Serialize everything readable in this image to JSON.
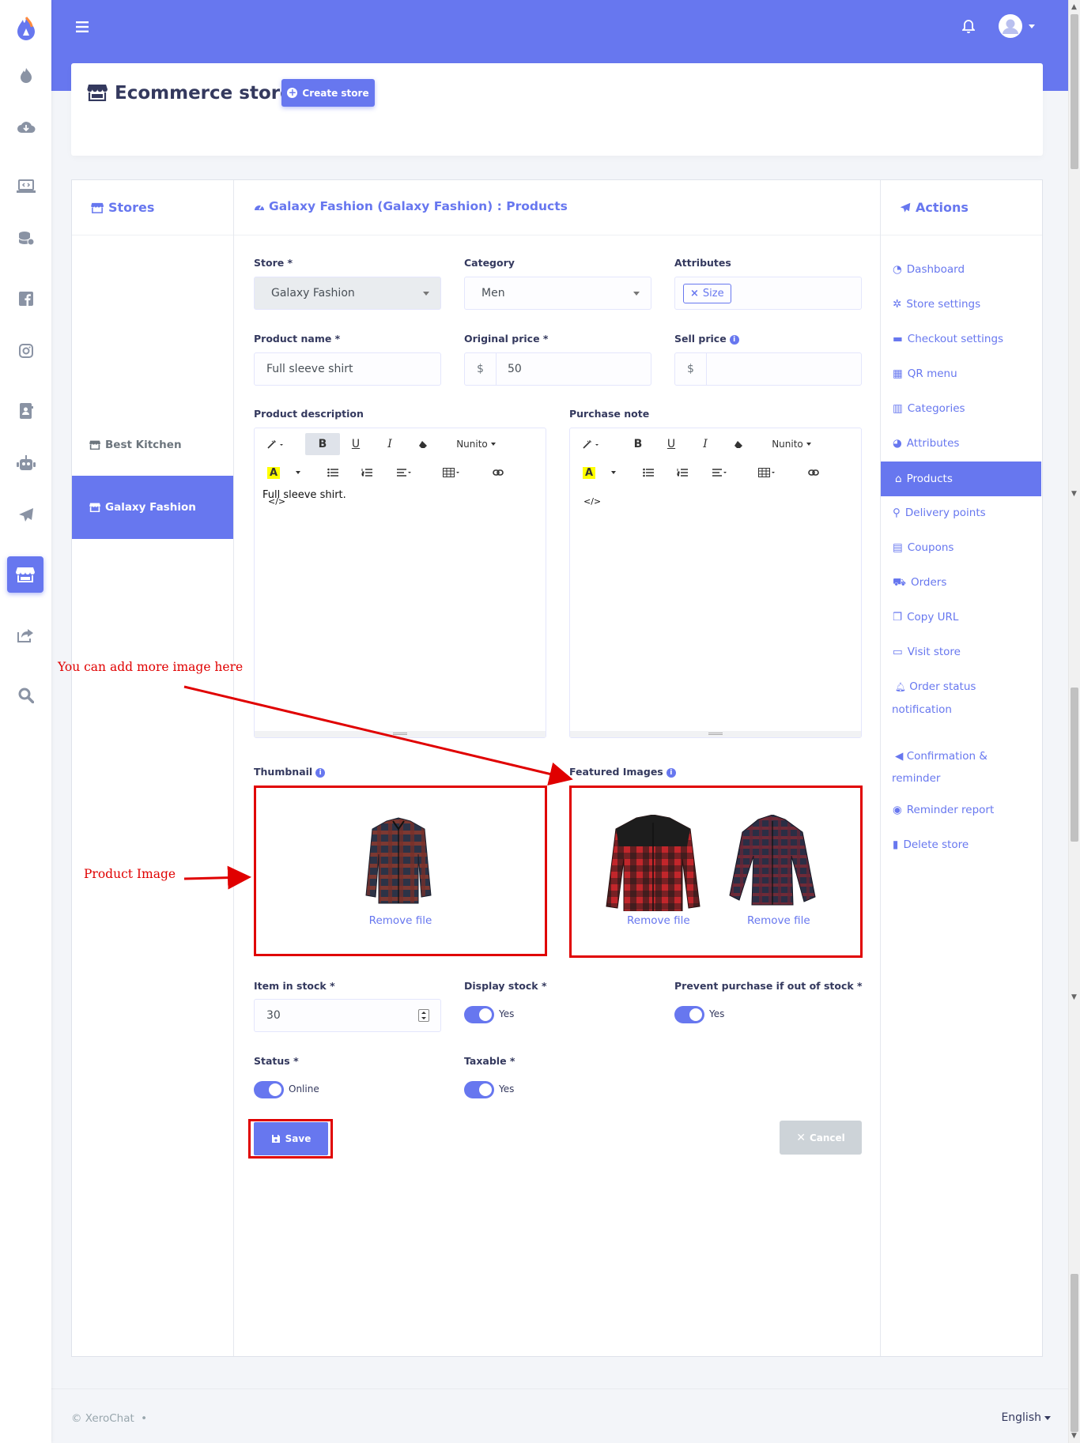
{
  "app": {
    "brand_icon": "flame-app-logo-icon"
  },
  "rail": {
    "icons": [
      "logo-icon",
      "fire-icon",
      "cloud-download-icon",
      "laptop-code-icon",
      "database-icon",
      "facebook-icon",
      "instagram-icon",
      "contact-book-icon",
      "robot-icon",
      "paper-plane-icon",
      "store-icon",
      "share-icon",
      "search-icon"
    ],
    "active": "store-icon"
  },
  "topbar": {
    "menu_icon": "hamburger-icon",
    "bell_icon": "bell-icon",
    "avatar_icon": "user-avatar-icon"
  },
  "header": {
    "title": "Ecommerce store",
    "create_button": "Create store"
  },
  "stores": {
    "heading": "Stores",
    "items": [
      {
        "label": "Best Kitchen",
        "active": false
      },
      {
        "label": "Galaxy Fashion",
        "active": true
      }
    ]
  },
  "main": {
    "title": "Galaxy Fashion (Galaxy Fashion) : Products"
  },
  "form": {
    "store_label": "Store *",
    "store_value": "Galaxy Fashion",
    "category_label": "Category",
    "category_value": "Men",
    "attributes_label": "Attributes",
    "attribute_tag": "Size",
    "product_name_label": "Product name *",
    "product_name_value": "Full sleeve shirt",
    "original_price_label": "Original price *",
    "currency": "$",
    "original_price_value": "50",
    "sell_price_label": "Sell price",
    "sell_price_value": "",
    "description_label": "Product description",
    "description_text": "Full sleeve shirt.",
    "purchase_note_label": "Purchase note",
    "font_name": "Nunito",
    "code_view": "</>",
    "thumbnail_label": "Thumbnail",
    "featured_label": "Featured Images",
    "remove_file": "Remove file",
    "stock_label": "Item in stock *",
    "stock_value": "30",
    "display_stock_label": "Display stock *",
    "display_stock_value": "Yes",
    "prevent_label": "Prevent purchase if out of stock *",
    "prevent_value": "Yes",
    "status_label": "Status *",
    "status_value": "Online",
    "taxable_label": "Taxable *",
    "taxable_value": "Yes",
    "save": "Save",
    "cancel": "Cancel"
  },
  "actions": {
    "heading": "Actions",
    "items": [
      {
        "label": "Dashboard",
        "icon": "dashboard-icon"
      },
      {
        "label": "Store settings",
        "icon": "gear-icon"
      },
      {
        "label": "Checkout settings",
        "icon": "credit-card-icon"
      },
      {
        "label": "QR menu",
        "icon": "qrcode-icon"
      },
      {
        "label": "Categories",
        "icon": "columns-icon"
      },
      {
        "label": "Attributes",
        "icon": "palette-icon"
      },
      {
        "label": "Products",
        "icon": "store-icon",
        "active": true
      },
      {
        "label": "Delivery points",
        "icon": "map-marker-icon"
      },
      {
        "label": "Coupons",
        "icon": "coupon-icon"
      },
      {
        "label": "Orders",
        "icon": "cart-icon"
      },
      {
        "label": "Copy URL",
        "icon": "copy-icon"
      },
      {
        "label": "Visit store",
        "icon": "link-icon"
      },
      {
        "label": "Order status notification",
        "icon": "bell-icon"
      },
      {
        "label": "Confirmation & reminder",
        "icon": "bullhorn-icon"
      },
      {
        "label": "Reminder report",
        "icon": "eye-icon"
      },
      {
        "label": "Delete store",
        "icon": "trash-icon"
      }
    ]
  },
  "annotations": {
    "more_images": "You can add more image here",
    "product_image": "Product Image"
  },
  "footer": {
    "copyright": "© XeroChat",
    "bullet": "•",
    "language": "English"
  },
  "colors": {
    "primary": "#6777ef",
    "annotation_red": "#e00000",
    "text_dark": "#34395e"
  }
}
